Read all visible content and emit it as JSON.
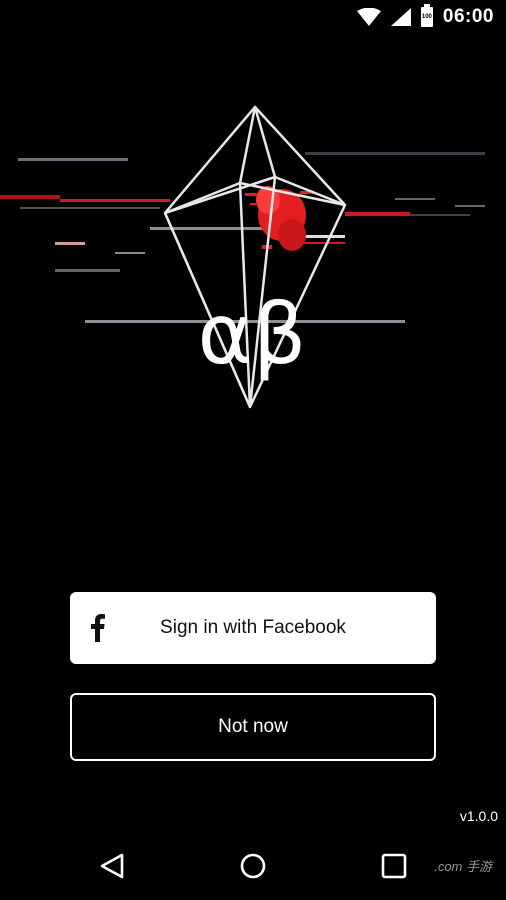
{
  "status_bar": {
    "time": "06:00",
    "battery_level": "100",
    "icons": [
      "wifi-icon",
      "cell-signal-icon",
      "battery-icon"
    ]
  },
  "hero": {
    "logo_text": "αβ",
    "colors": {
      "accent": "#e41e1e",
      "line": "#e8e8e8"
    }
  },
  "buttons": {
    "facebook_label": "Sign in with Facebook",
    "not_now_label": "Not now"
  },
  "version": "v1.0.0",
  "nav_bar": {
    "items": [
      "back-icon",
      "home-icon",
      "recents-icon"
    ]
  },
  "watermark": ".com 手游"
}
